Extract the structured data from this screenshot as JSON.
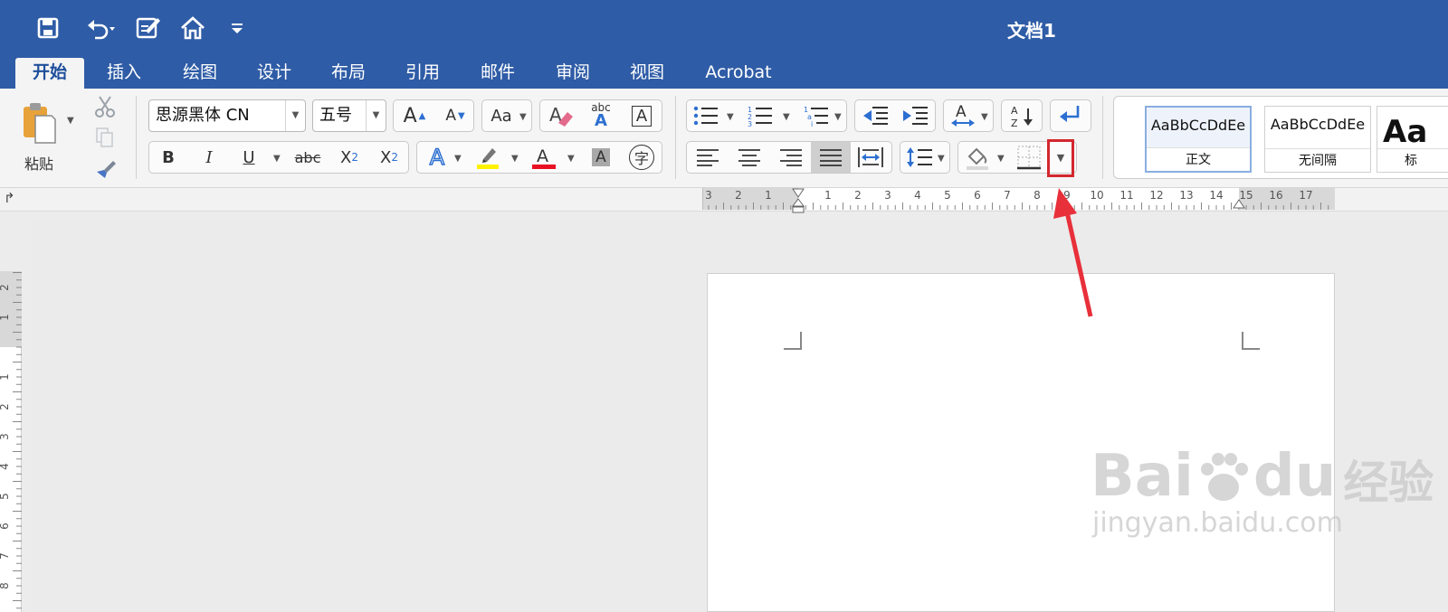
{
  "window": {
    "title": "文档1"
  },
  "tabs": [
    "开始",
    "插入",
    "绘图",
    "设计",
    "布局",
    "引用",
    "邮件",
    "审阅",
    "视图",
    "Acrobat"
  ],
  "active_tab": "开始",
  "clipboard": {
    "paste_label": "粘贴"
  },
  "font": {
    "family_value": "思源黑体 CN",
    "size_value": "五号"
  },
  "format_glyphs": {
    "bold": "B",
    "italic": "I",
    "underline": "U",
    "strike": "abc",
    "subscript": "X",
    "subscript_mark": "2",
    "superscript": "X",
    "superscript_mark": "2",
    "char_border": "A",
    "phonetic": "字",
    "grow": "A",
    "shrink": "A",
    "case": "Aa",
    "text_effects": "A",
    "font_color": "A",
    "char_shading": "A",
    "abc": "abc"
  },
  "styles": [
    {
      "sample": "AaBbCcDdEe",
      "label": "正文",
      "selected": true
    },
    {
      "sample": "AaBbCcDdEe",
      "label": "无间隔",
      "selected": false
    },
    {
      "sample": "Aa",
      "label": "标",
      "selected": false
    }
  ],
  "ruler_horizontal": [
    "3",
    "2",
    "1",
    "1",
    "2",
    "3",
    "4",
    "5",
    "6",
    "7",
    "8",
    "9",
    "10",
    "11",
    "12",
    "13",
    "14",
    "15",
    "16",
    "17"
  ],
  "ruler_vertical": [
    "2",
    "1",
    "1",
    "2",
    "3",
    "4",
    "5",
    "6",
    "7",
    "8"
  ],
  "watermark": {
    "brand": "Bai",
    "brand2": "du",
    "cn": "经验",
    "url": "jingyan.baidu.com"
  },
  "colors": {
    "titlebar": "#2f5ca6",
    "highlight": "#d3272e",
    "arrow": "#e8303a",
    "font_color_bar": "#e81123",
    "highlight_bar": "#fff200"
  },
  "icons": {
    "save": "save-icon",
    "undo": "undo-icon",
    "edit": "edit-doc-icon",
    "home": "home-icon",
    "customize": "customize-toolbar-icon",
    "cut": "scissors-icon",
    "copy": "copy-icon",
    "format_painter": "format-painter-icon",
    "clear": "eraser-icon",
    "bullets": "bullet-list-icon",
    "numbering": "numbered-list-icon",
    "multilevel": "multilevel-list-icon",
    "decrease_indent": "decrease-indent-icon",
    "increase_indent": "increase-indent-icon",
    "sort": "sort-icon",
    "show_marks": "paragraph-return-icon",
    "align_left": "align-left-icon",
    "align_center": "align-center-icon",
    "align_right": "align-right-icon",
    "justify": "justify-icon",
    "distributed": "distributed-icon",
    "line_spacing": "line-spacing-icon",
    "shading": "paint-bucket-icon",
    "borders": "borders-icon",
    "tab_stop": "tab-stop-icon"
  }
}
